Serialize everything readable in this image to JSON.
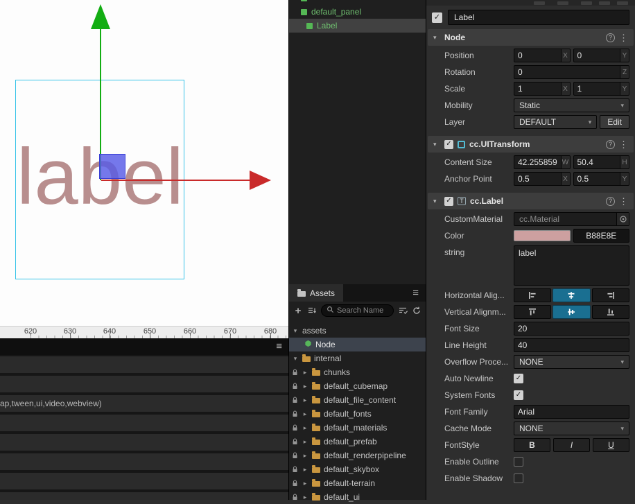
{
  "icons": {
    "check": "✓",
    "plus": "+",
    "menu": "≡",
    "help": "?",
    "kebab": "⋮",
    "chevron_down": "▾",
    "chevron_right": "▸",
    "label_component": "T"
  },
  "scene": {
    "label_text": "label",
    "label_color": "#B88E8E",
    "ruler": [
      "620",
      "630",
      "640",
      "650",
      "660",
      "670",
      "680"
    ]
  },
  "console": {
    "log_text": "ap,tween,ui,video,webview)"
  },
  "hierarchy": {
    "items": [
      {
        "label": "default_panel"
      },
      {
        "label": "Label"
      }
    ]
  },
  "assets": {
    "title": "Assets",
    "search_placeholder": "Search Name",
    "tree": [
      "assets",
      "Node",
      "internal",
      "chunks",
      "default_cubemap",
      "default_file_content",
      "default_fonts",
      "default_materials",
      "default_prefab",
      "default_renderpipeline",
      "default_skybox",
      "default-terrain",
      "default_ui"
    ]
  },
  "inspector": {
    "name_value": "Label",
    "suffix": {
      "x": "X",
      "y": "Y",
      "z": "Z",
      "w": "W",
      "h": "H"
    },
    "node": {
      "title": "Node",
      "position_label": "Position",
      "position_x": "0",
      "position_y": "0",
      "rotation_label": "Rotation",
      "rotation_z": "0",
      "scale_label": "Scale",
      "scale_x": "1",
      "scale_y": "1",
      "mobility_label": "Mobility",
      "mobility_value": "Static",
      "layer_label": "Layer",
      "layer_value": "DEFAULT",
      "edit_label": "Edit"
    },
    "uitransform": {
      "title": "cc.UITransform",
      "content_size_label": "Content Size",
      "content_w": "42.255859",
      "content_h": "50.4",
      "anchor_label": "Anchor Point",
      "anchor_x": "0.5",
      "anchor_y": "0.5"
    },
    "label": {
      "title": "cc.Label",
      "custom_material_label": "CustomMaterial",
      "custom_material_value": "cc.Material",
      "color_label": "Color",
      "color_hex": "B88E8E",
      "color_swatch": "#CDA0A0",
      "string_label": "string",
      "string_value": "label",
      "h_align_label": "Horizontal Alig...",
      "v_align_label": "Vertical Alignm...",
      "font_size_label": "Font Size",
      "font_size_value": "20",
      "line_height_label": "Line Height",
      "line_height_value": "40",
      "overflow_label": "Overflow Proce...",
      "overflow_value": "NONE",
      "auto_newline_label": "Auto Newline",
      "system_fonts_label": "System Fonts",
      "font_family_label": "Font Family",
      "font_family_value": "Arial",
      "cache_mode_label": "Cache Mode",
      "cache_mode_value": "NONE",
      "font_style_label": "FontStyle",
      "bold": "B",
      "italic": "I",
      "underline": "U",
      "enable_outline_label": "Enable Outline",
      "enable_shadow_label": "Enable Shadow"
    }
  }
}
